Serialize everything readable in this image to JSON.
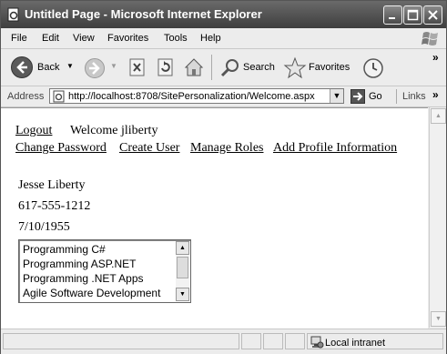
{
  "window": {
    "title": "Untitled Page - Microsoft Internet Explorer"
  },
  "menu": [
    "File",
    "Edit",
    "View",
    "Favorites",
    "Tools",
    "Help"
  ],
  "toolbar": {
    "back": "Back",
    "search": "Search",
    "favorites": "Favorites"
  },
  "address": {
    "label": "Address",
    "url": "http://localhost:8708/SitePersonalization/Welcome.aspx",
    "go": "Go",
    "links": "Links"
  },
  "page": {
    "logout": "Logout",
    "welcome": "Welcome jliberty",
    "nav": [
      "Change Password",
      "Create User",
      "Manage Roles",
      "Add Profile Information"
    ],
    "name": "Jesse Liberty",
    "phone": "617-555-1212",
    "birthdate": "7/10/1955",
    "books": [
      "Programming C#",
      "Programming ASP.NET",
      "Programming .NET Apps",
      "Agile Software Development"
    ]
  },
  "status": {
    "zone": "Local intranet"
  },
  "icons": [
    "ie-page-icon",
    "minimize-icon",
    "maximize-icon",
    "close-icon",
    "windows-logo-icon",
    "back-arrow-icon",
    "forward-arrow-icon",
    "stop-icon",
    "refresh-icon",
    "home-icon",
    "search-icon",
    "favorites-star-icon",
    "history-icon",
    "go-arrow-icon",
    "intranet-icon"
  ]
}
